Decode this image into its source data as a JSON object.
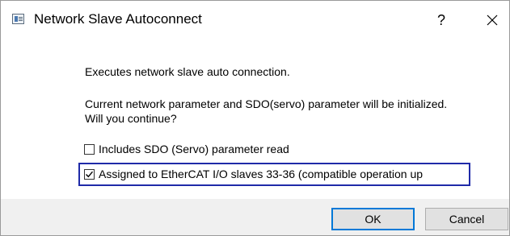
{
  "window": {
    "title": "Network Slave Autoconnect",
    "help_label": "?",
    "close_icon": "close-icon",
    "app_icon": "app-window-icon"
  },
  "message": {
    "line1": "Executes network slave auto connection.",
    "line2": "Current network parameter and SDO(servo) parameter will be initialized.",
    "line3": "Will you continue?"
  },
  "options": [
    {
      "label": "Includes SDO (Servo) parameter read",
      "checked": false
    },
    {
      "label": "Assigned to EtherCAT I/O slaves 33-36 (compatible operation up",
      "checked": true
    }
  ],
  "buttons": {
    "ok": "OK",
    "cancel": "Cancel"
  },
  "colors": {
    "highlight_border": "#1f2aa8",
    "default_button_border": "#0078d7",
    "footer_bg": "#f0f0f0"
  }
}
